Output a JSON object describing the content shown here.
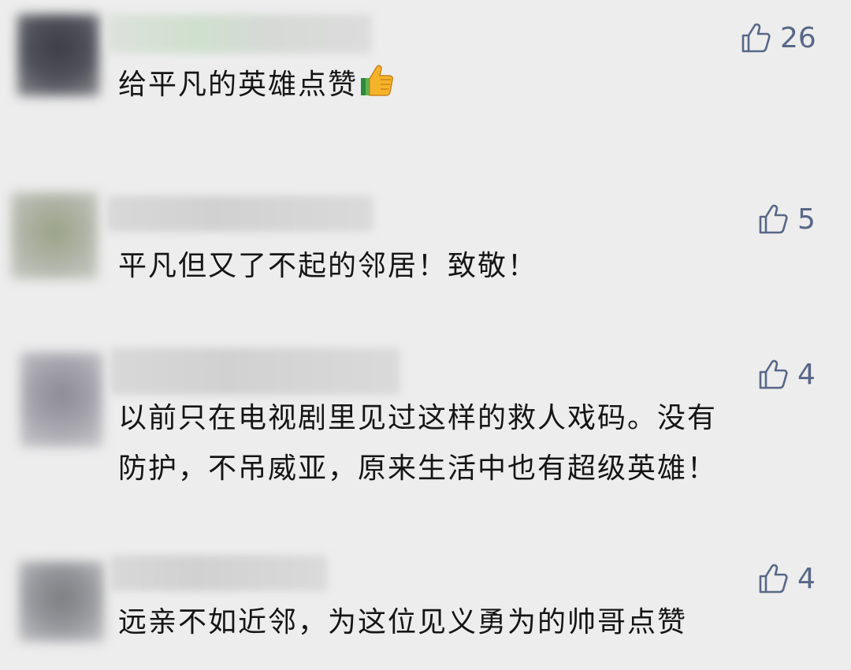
{
  "comments": [
    {
      "text": "给平凡的英雄点赞",
      "likes": "26",
      "emoji": "thumbs-up-emoji",
      "colors": {
        "avatar": "#4b4d53",
        "name": "#d6dad4"
      }
    },
    {
      "text": "平凡但又了不起的邻居！致敬！",
      "likes": "5",
      "colors": {
        "avatar": "#a9b09b",
        "name": "#d7d7d7"
      }
    },
    {
      "text": "以前只在电视剧里见过这样的救人戏码。没有防护，不吊威亚，原来生活中也有超级英雄！",
      "line1": "以前只在电视剧里见过这样的救人戏码。没有",
      "line2": "防护，不吊威亚，原来生活中也有超级英雄！",
      "likes": "4",
      "colors": {
        "avatar": "#9c9ca3",
        "name": "#d8d8d8"
      }
    },
    {
      "text": "远亲不如近邻，为这位见义勇为的帅哥点赞",
      "likes": "4",
      "colors": {
        "avatar": "#8e8f93",
        "name": "#d8d8d8"
      }
    }
  ],
  "colors": {
    "background": "#ededed",
    "text": "#151515",
    "like": "#586787"
  },
  "icons": {
    "like": "thumbs-up-outline-icon"
  }
}
